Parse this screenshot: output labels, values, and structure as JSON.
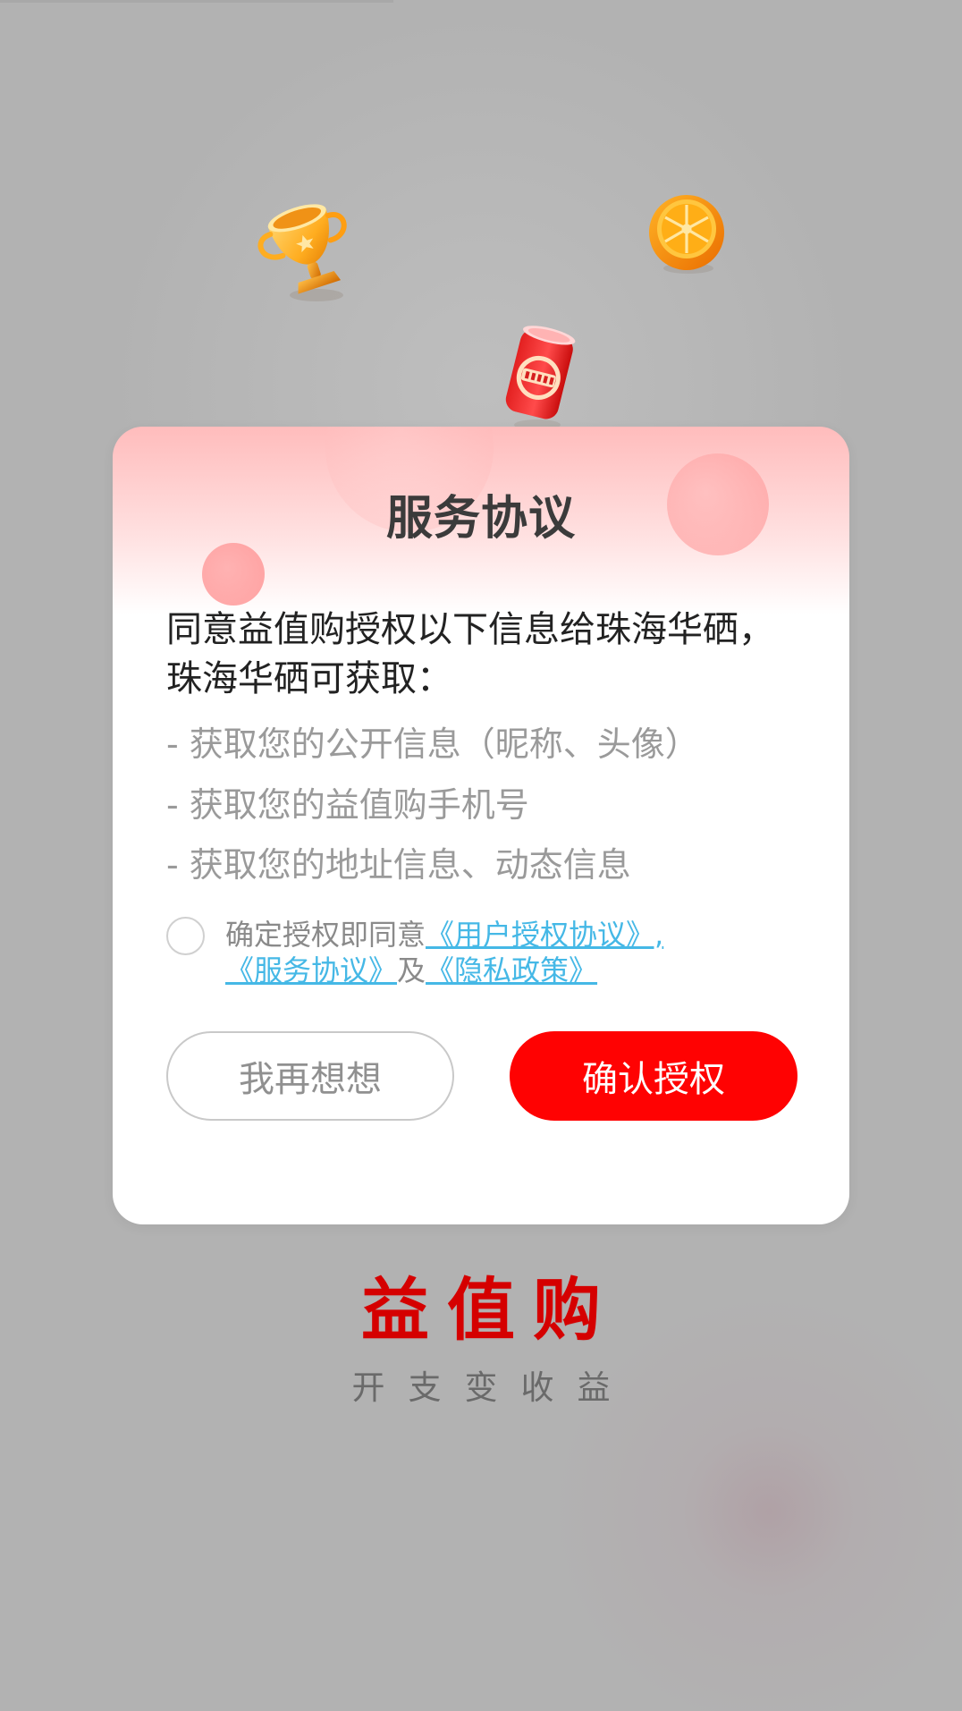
{
  "dialog": {
    "title": "服务协议",
    "intro": {
      "line1": "同意益值购授权以下信息给珠海华硒，",
      "line2": "珠海华硒可获取："
    },
    "permissions": [
      "- 获取您的公开信息（昵称、头像）",
      "- 获取您的益值购手机号",
      "- 获取您的地址信息、动态信息"
    ],
    "agreement": {
      "prefix": "确定授权即同意",
      "link_user_auth": "《用户授权协议》,",
      "link_service": "《服务协议》",
      "conjunction": "及",
      "link_privacy": "《隐私政策》"
    },
    "buttons": {
      "cancel": "我再想想",
      "confirm": "确认授权"
    }
  },
  "brand": {
    "name": "益值购",
    "slogan": "开支变收益"
  },
  "colors": {
    "primary_red": "#ff0202",
    "brand_red": "#d50000",
    "link_blue": "#45b8e6",
    "overlay_gray": "#b2b2b2"
  },
  "icons": {
    "trophy": "trophy-icon",
    "orange": "orange-icon",
    "can": "can-icon"
  }
}
